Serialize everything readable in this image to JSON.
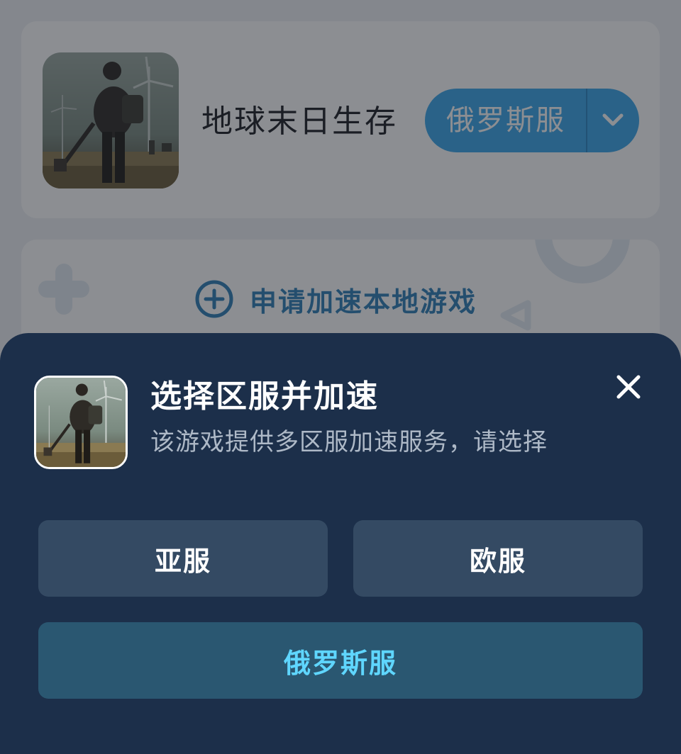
{
  "game_card": {
    "title": "地球末日生存",
    "server_selected": "俄罗斯服",
    "thumbnail_icon": "game-cover-survivor-image",
    "dropdown_icon": "chevron-down-icon"
  },
  "request_card": {
    "label": "申请加速本地游戏",
    "icon": "add-circle-icon"
  },
  "sheet": {
    "title": "选择区服并加速",
    "subtitle": "该游戏提供多区服加速服务，请选择",
    "close_icon": "close-icon",
    "regions": [
      {
        "label": "亚服",
        "selected": false
      },
      {
        "label": "欧服",
        "selected": false
      },
      {
        "label": "俄罗斯服",
        "selected": true
      }
    ]
  },
  "colors": {
    "accent_blue": "#3aa6ea",
    "sheet_bg": "#1c2f4a",
    "selected_text": "#5fd6ff"
  }
}
